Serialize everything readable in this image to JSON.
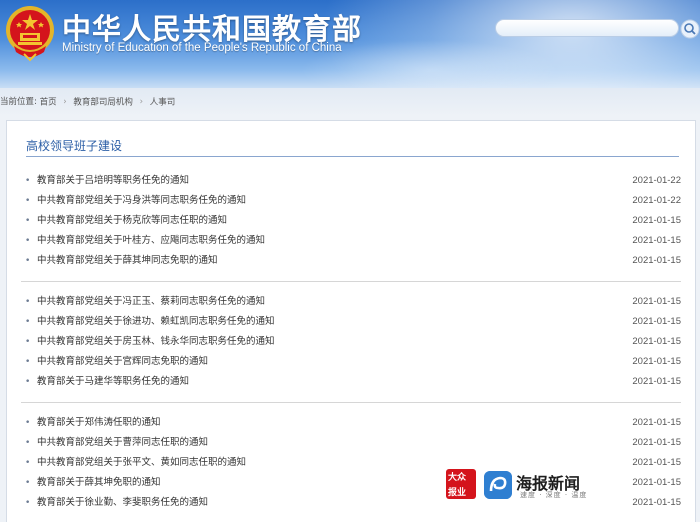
{
  "header": {
    "title": "中华人民共和国教育部",
    "subtitle": "Ministry of Education of the People's Republic of China",
    "search": {
      "value": "",
      "placeholder": ""
    }
  },
  "breadcrumb": {
    "prefix": "当前位置:",
    "items": [
      "首页",
      "教育部司局机构",
      "人事司"
    ]
  },
  "section": {
    "title": "高校领导班子建设",
    "groups": [
      [
        {
          "title": "教育部关于吕培明等职务任免的通知",
          "date": "2021-01-22"
        },
        {
          "title": "中共教育部党组关于冯身洪等同志职务任免的通知",
          "date": "2021-01-22"
        },
        {
          "title": "中共教育部党组关于杨克欣等同志任职的通知",
          "date": "2021-01-15"
        },
        {
          "title": "中共教育部党组关于叶桂方、应飚同志职务任免的通知",
          "date": "2021-01-15"
        },
        {
          "title": "中共教育部党组关于薛其坤同志免职的通知",
          "date": "2021-01-15"
        }
      ],
      [
        {
          "title": "中共教育部党组关于冯正玉、蔡莉同志职务任免的通知",
          "date": "2021-01-15"
        },
        {
          "title": "中共教育部党组关于徐进功、赖虹凯同志职务任免的通知",
          "date": "2021-01-15"
        },
        {
          "title": "中共教育部党组关于房玉林、钱永华同志职务任免的通知",
          "date": "2021-01-15"
        },
        {
          "title": "中共教育部党组关于宫辉同志免职的通知",
          "date": "2021-01-15"
        },
        {
          "title": "教育部关于马建华等职务任免的通知",
          "date": "2021-01-15"
        }
      ],
      [
        {
          "title": "教育部关于郑伟涛任职的通知",
          "date": "2021-01-15"
        },
        {
          "title": "中共教育部党组关于曹萍同志任职的通知",
          "date": "2021-01-15"
        },
        {
          "title": "中共教育部党组关于张平文、黄如同志任职的通知",
          "date": "2021-01-15"
        },
        {
          "title": "教育部关于薛其坤免职的通知",
          "date": "2021-01-15"
        },
        {
          "title": "教育部关于徐业勤、李斐职务任免的通知",
          "date": "2021-01-15"
        }
      ]
    ]
  },
  "watermark": {
    "badge_top": "大众",
    "badge_bottom": "报业",
    "brand": "海报新闻",
    "tagline": "速度 · 深度 · 温度"
  },
  "colors": {
    "accent": "#2b5ea6",
    "emblem_red": "#d4141c",
    "emblem_gold": "#f3c530"
  }
}
